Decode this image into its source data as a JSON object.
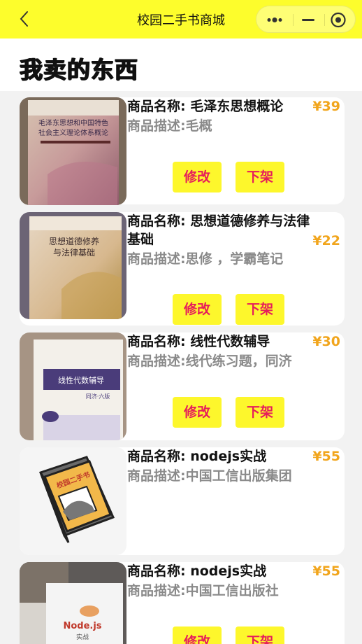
{
  "app": {
    "title": "校园二手书商城"
  },
  "page": {
    "title": "我卖的东西"
  },
  "icons": {
    "back": "chevron-left-icon",
    "more": "more-dots-icon",
    "minimize": "minus-icon",
    "close": "target-circle-icon"
  },
  "colors": {
    "navbar": "#fdfd2c",
    "button": "#fdf72c",
    "button_text": "#e61d5b",
    "price": "#f1a51c",
    "desc": "#8a8a8a"
  },
  "items": [
    {
      "name": "商品名称: 毛泽东思想概论",
      "desc": "商品描述:毛概",
      "price": "¥39",
      "edit": "修改",
      "delist": "下架",
      "thumb_text": [
        "毛泽东思想和中国特色",
        "社会主义理论体系概论"
      ]
    },
    {
      "name": "商品名称: 思想道德修养与法律基础",
      "desc": "商品描述:思修 ，学霸笔记",
      "price": "¥22",
      "edit": "修改",
      "delist": "下架",
      "thumb_text": [
        "思想道德修养",
        "与法律基础"
      ]
    },
    {
      "name": "商品名称: 线性代数辅导",
      "desc": "商品描述:线代练习题，同济",
      "price": "¥30",
      "edit": "修改",
      "delist": "下架",
      "thumb_text": [
        "线性代数辅导",
        "同济·六版"
      ]
    },
    {
      "name": "商品名称: nodejs实战",
      "desc": "商品描述:中国工信出版集团",
      "price": "¥55",
      "thumb_text": [
        "校园二手书"
      ]
    },
    {
      "name": "商品名称: nodejs实战",
      "desc": "商品描述:中国工信出版社",
      "price": "¥55",
      "edit": "修改",
      "delist": "下架",
      "thumb_text": [
        "Node.js",
        "实战"
      ]
    }
  ]
}
